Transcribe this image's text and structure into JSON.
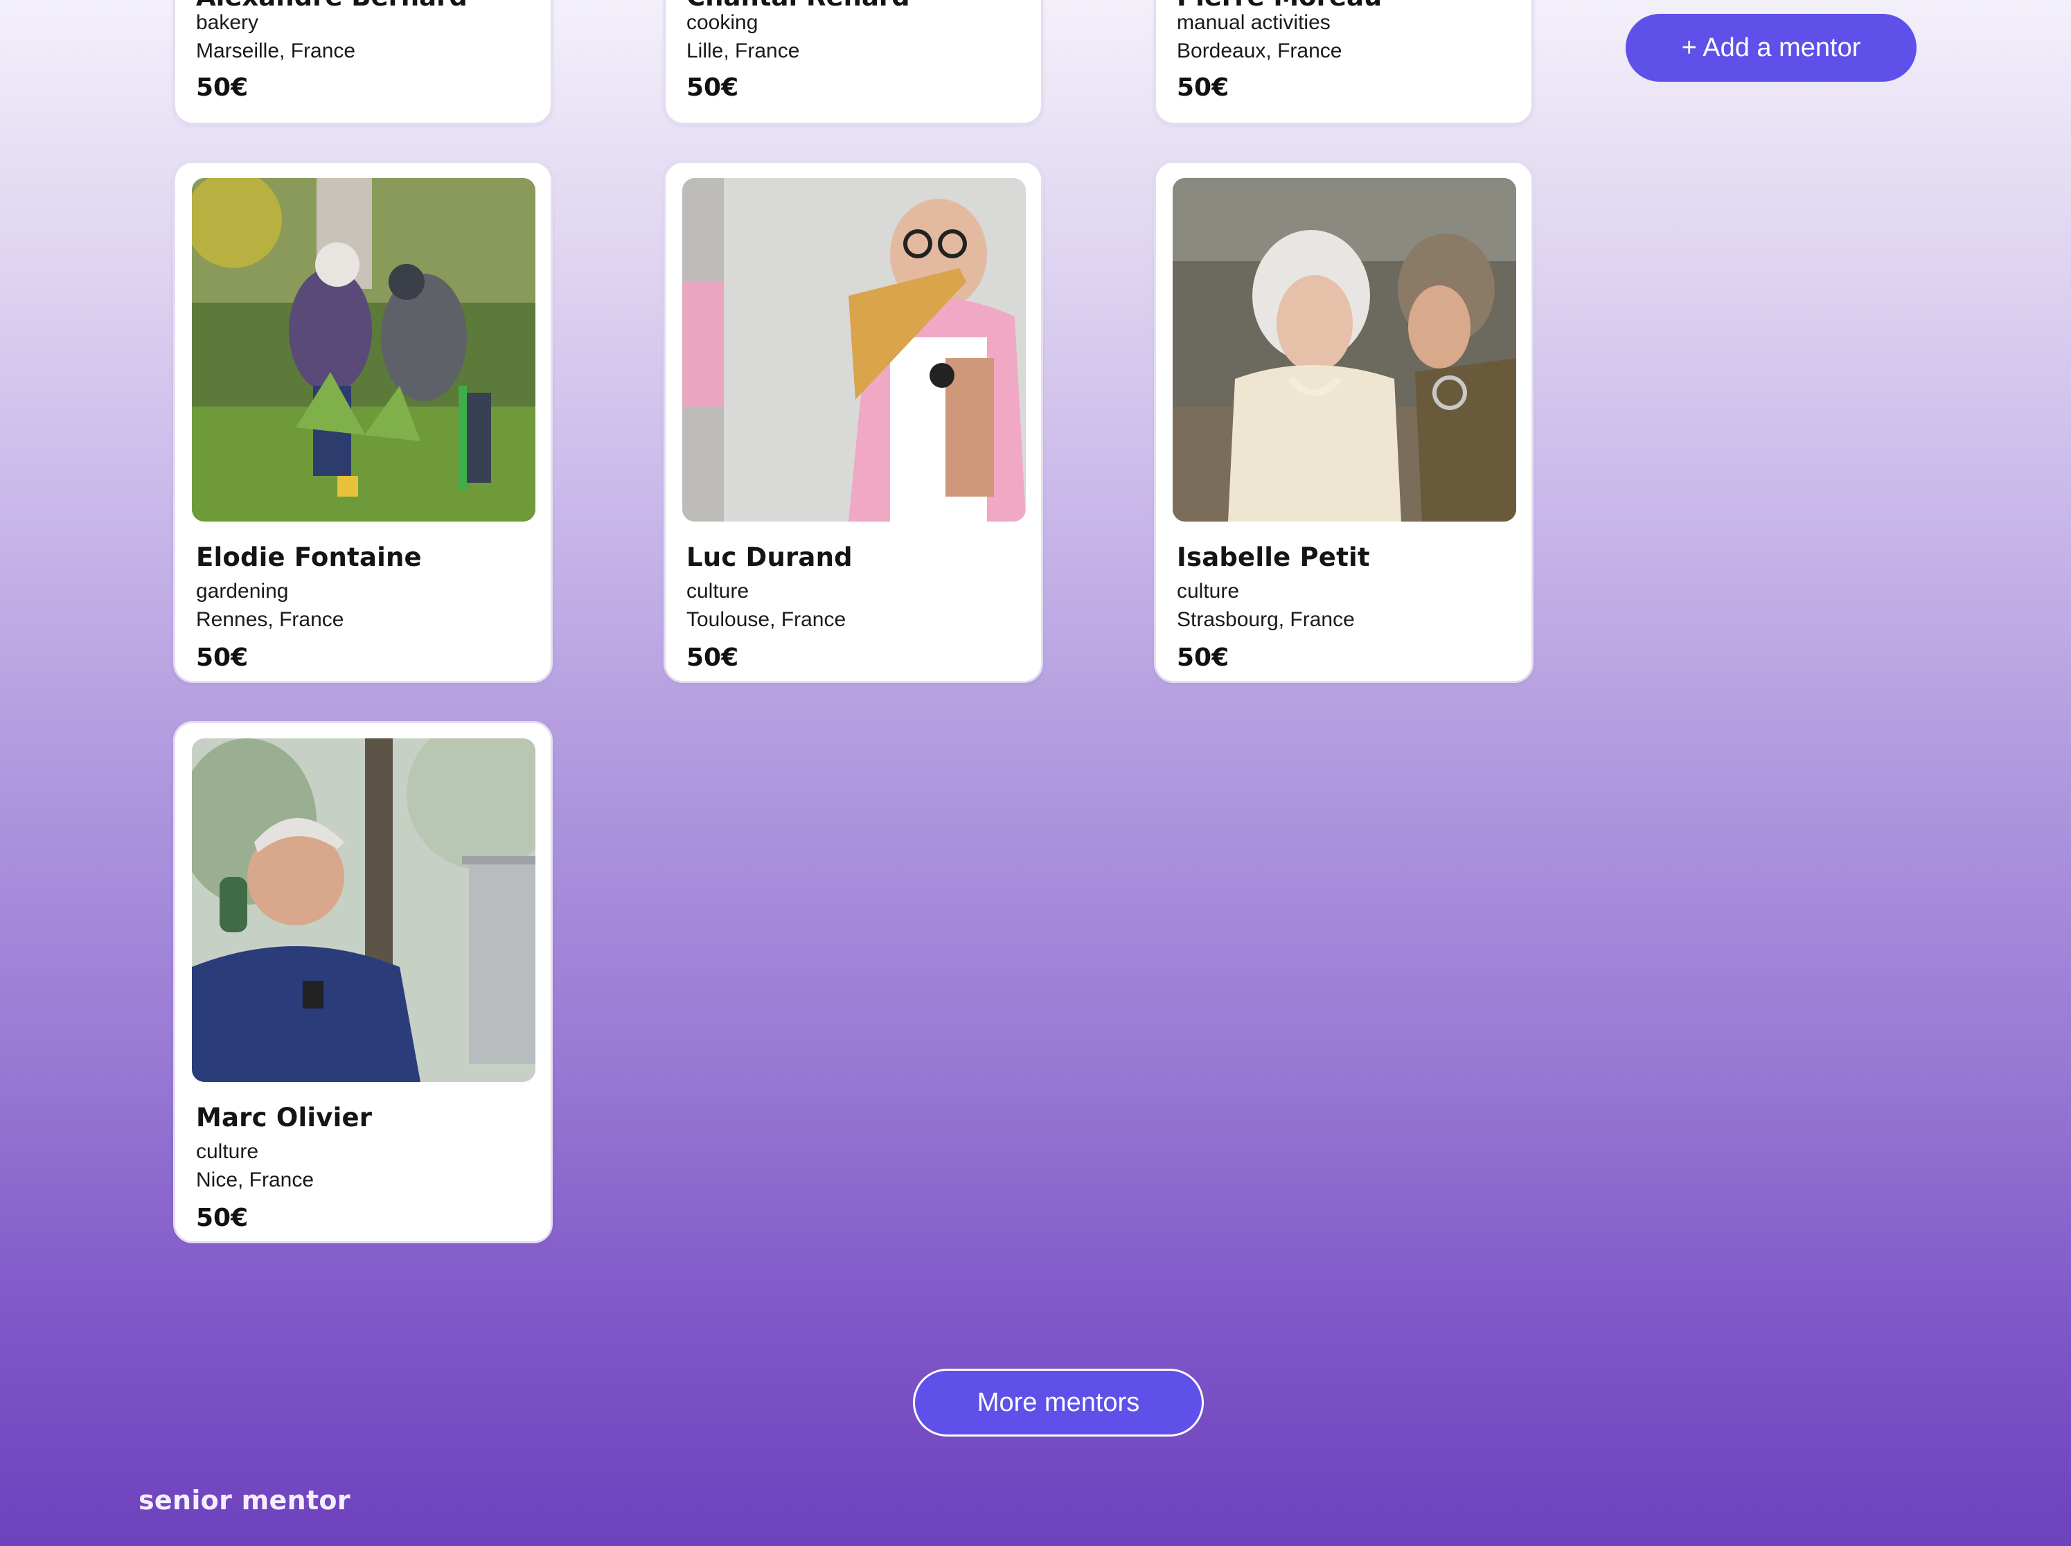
{
  "header_actions": {
    "add_mentor_label": "+ Add a mentor"
  },
  "mentors_partial": [
    {
      "name": "Alexandre Bernard",
      "category": "bakery",
      "location": "Marseille, France",
      "price": "50€"
    },
    {
      "name": "Chantal Renard",
      "category": "cooking",
      "location": "Lille, France",
      "price": "50€"
    },
    {
      "name": "Pierre Moreau",
      "category": "manual activities",
      "location": "Bordeaux, France",
      "price": "50€"
    }
  ],
  "mentors": [
    {
      "name": "Elodie Fontaine",
      "category": "gardening",
      "location": "Rennes, France",
      "price": "50€",
      "photo": "two women gardening outdoors"
    },
    {
      "name": "Luc Durand",
      "category": "culture",
      "location": "Toulouse, France",
      "price": "50€",
      "photo": "bald man with glasses playing pan flute"
    },
    {
      "name": "Isabelle Petit",
      "category": "culture",
      "location": "Strasbourg, France",
      "price": "50€",
      "photo": "elderly woman smiling with younger woman"
    },
    {
      "name": "Marc Olivier",
      "category": "culture",
      "location": "Nice, France",
      "price": "50€",
      "photo": "smiling man on phone with laptop"
    }
  ],
  "pagination": {
    "more_label": "More mentors"
  },
  "footer": {
    "logo_text": "senior mentor"
  },
  "colors": {
    "accent": "#6050ea",
    "card_bg": "#ffffff",
    "gradient_top": "#f3f0fa",
    "gradient_bottom": "#6e41bd"
  }
}
